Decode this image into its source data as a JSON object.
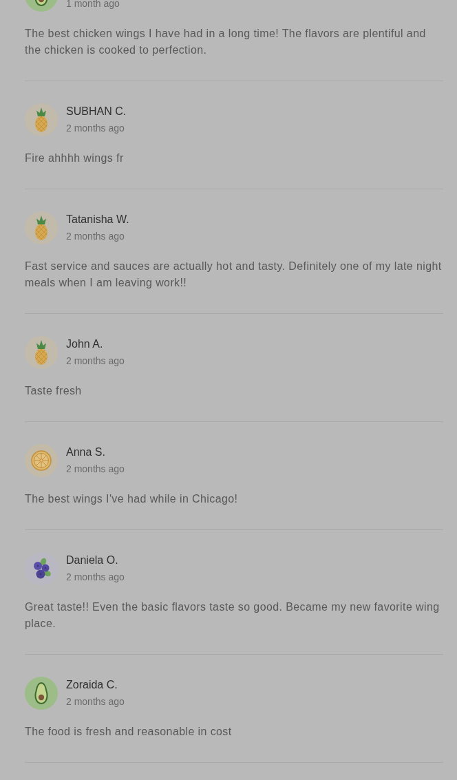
{
  "reviews": [
    {
      "avatar": {
        "kind": "avocado"
      },
      "time": "1 month ago",
      "text": "The best chicken wings I have had in a long time! The flavors are plentiful and the chicken is cooked to perfection."
    },
    {
      "avatar": {
        "kind": "pineapple"
      },
      "name": "SUBHAN C.",
      "time": "2 months ago",
      "text": "Fire ahhhh wings fr"
    },
    {
      "avatar": {
        "kind": "pineapple"
      },
      "name": "Tatanisha W.",
      "time": "2 months ago",
      "text": "Fast service and sauces are actually hot and tasty. Definitely one of my late night meals when I am leaving work!!"
    },
    {
      "avatar": {
        "kind": "pineapple"
      },
      "name": "John A.",
      "time": "2 months ago",
      "text": "Taste fresh"
    },
    {
      "avatar": {
        "kind": "citrus"
      },
      "name": "Anna S.",
      "time": "2 months ago",
      "text": "The best wings I've had while in Chicago!"
    },
    {
      "avatar": {
        "kind": "blueberry"
      },
      "name": "Daniela O.",
      "time": "2 months ago",
      "text": "Great taste!! Even the basic flavors taste so good. Became my new favorite wing place."
    },
    {
      "avatar": {
        "kind": "avocado"
      },
      "name": "Zoraida C.",
      "time": "2 months ago",
      "text": "The food is fresh and reasonable in cost"
    }
  ]
}
